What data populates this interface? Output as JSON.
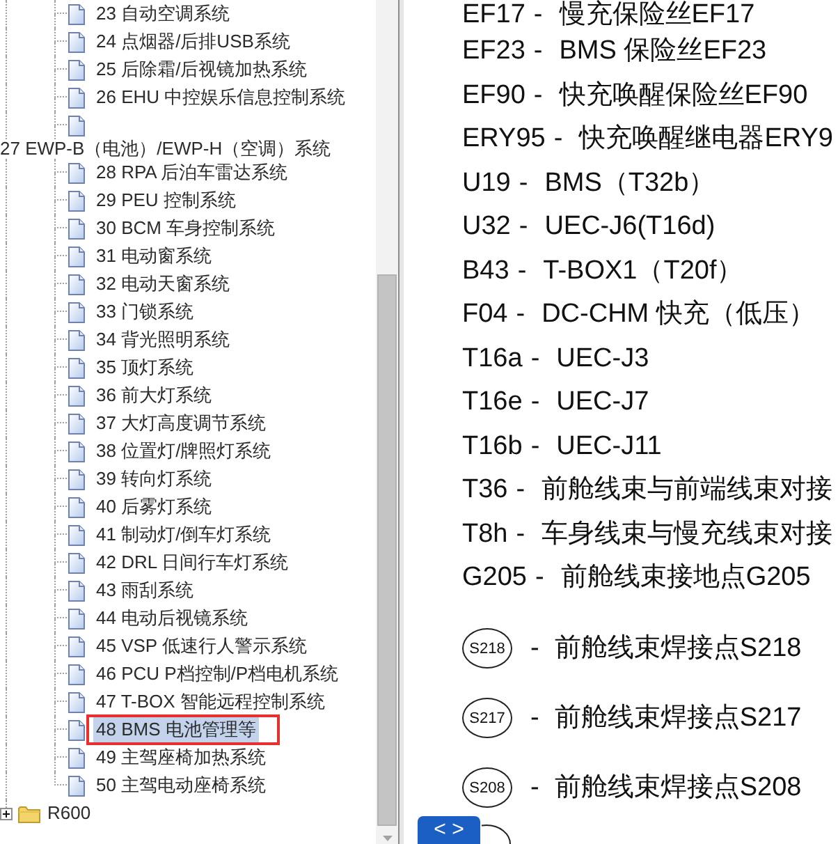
{
  "tree": [
    {
      "kind": "branch",
      "children": [
        {
          "kind": "document",
          "label": "23 自动空调系统",
          "selected": false,
          "annotated": false
        },
        {
          "kind": "document",
          "label": "24 点烟器/后排USB系统",
          "selected": false,
          "annotated": false
        },
        {
          "kind": "document",
          "label": "25 后除霜/后视镜加热系统",
          "selected": false,
          "annotated": false
        },
        {
          "kind": "document",
          "label": "26 EHU 中控娱乐信息控制系统",
          "selected": false,
          "annotated": false
        },
        {
          "kind": "document",
          "selected": false,
          "annotated": false
        },
        {
          "kind": "text_line",
          "label": "27 EWP-B（电池）/EWP-H（空调）系统"
        },
        {
          "kind": "document",
          "label": "28 RPA 后泊车雷达系统",
          "selected": false,
          "annotated": false
        },
        {
          "kind": "document",
          "label": "29 PEU 控制系统",
          "selected": false,
          "annotated": false
        },
        {
          "kind": "document",
          "label": "30 BCM 车身控制系统",
          "selected": false,
          "annotated": false
        },
        {
          "kind": "document",
          "label": "31 电动窗系统",
          "selected": false,
          "annotated": false
        },
        {
          "kind": "document",
          "label": "32 电动天窗系统",
          "selected": false,
          "annotated": false
        },
        {
          "kind": "document",
          "label": "33 门锁系统",
          "selected": false,
          "annotated": false
        },
        {
          "kind": "document",
          "label": "34 背光照明系统",
          "selected": false,
          "annotated": false
        },
        {
          "kind": "document",
          "label": "35 顶灯系统",
          "selected": false,
          "annotated": false
        },
        {
          "kind": "document",
          "label": "36 前大灯系统",
          "selected": false,
          "annotated": false
        },
        {
          "kind": "document",
          "label": "37 大灯高度调节系统",
          "selected": false,
          "annotated": false
        },
        {
          "kind": "document",
          "label": "38 位置灯/牌照灯系统",
          "selected": false,
          "annotated": false
        },
        {
          "kind": "document",
          "label": "39 转向灯系统",
          "selected": false,
          "annotated": false
        },
        {
          "kind": "document",
          "label": "40 后雾灯系统",
          "selected": false,
          "annotated": false
        },
        {
          "kind": "document",
          "label": "41 制动灯/倒车灯系统",
          "selected": false,
          "annotated": false
        },
        {
          "kind": "document",
          "label": "42 DRL 日间行车灯系统",
          "selected": false,
          "annotated": false
        },
        {
          "kind": "document",
          "label": "43 雨刮系统",
          "selected": false,
          "annotated": false
        },
        {
          "kind": "document",
          "label": "44 电动后视镜系统",
          "selected": false,
          "annotated": false
        },
        {
          "kind": "document",
          "label": "45 VSP 低速行人警示系统",
          "selected": false,
          "annotated": false
        },
        {
          "kind": "document",
          "label": "46 PCU P档控制/P档电机系统",
          "selected": false,
          "annotated": false
        },
        {
          "kind": "document",
          "label": "47 T-BOX 智能远程控制系统",
          "selected": false,
          "annotated": false
        },
        {
          "kind": "document",
          "label": "48 BMS 电池管理等",
          "selected": true,
          "annotated": true
        },
        {
          "kind": "document",
          "label": "49 主驾座椅加热系统",
          "selected": false,
          "annotated": false
        },
        {
          "kind": "document",
          "label": "50 主驾电动座椅系统",
          "selected": false,
          "annotated": false
        }
      ]
    },
    {
      "kind": "folder",
      "label": "R600",
      "expanded": false,
      "selected": false
    }
  ],
  "legend": [
    {
      "kind": "connector",
      "code": "EF17",
      "separator": "-",
      "description": "慢充保险丝EF17"
    },
    {
      "kind": "connector",
      "code": "EF23",
      "separator": "-",
      "description": "BMS 保险丝EF23"
    },
    {
      "kind": "connector",
      "code": "EF90",
      "separator": "-",
      "description": "快充唤醒保险丝EF90"
    },
    {
      "kind": "connector",
      "code": "ERY95",
      "separator": "-",
      "description": "快充唤醒继电器ERY9"
    },
    {
      "kind": "connector",
      "code": "U19",
      "separator": "-",
      "description": "BMS（T32b）"
    },
    {
      "kind": "connector",
      "code": "U32",
      "separator": "-",
      "description": "UEC-J6(T16d)"
    },
    {
      "kind": "connector",
      "code": "B43",
      "separator": "-",
      "description": "T-BOX1（T20f）"
    },
    {
      "kind": "connector",
      "code": "F04",
      "separator": "-",
      "description": "DC-CHM 快充（低压）"
    },
    {
      "kind": "connector",
      "code": "T16a",
      "separator": "-",
      "description": "UEC-J3"
    },
    {
      "kind": "connector",
      "code": "T16e",
      "separator": "-",
      "description": "UEC-J7"
    },
    {
      "kind": "connector",
      "code": "T16b",
      "separator": "-",
      "description": "UEC-J11"
    },
    {
      "kind": "connector",
      "code": "T36",
      "separator": "-",
      "description": "前舱线束与前端线束对接"
    },
    {
      "kind": "connector",
      "code": "T8h",
      "separator": "-",
      "description": "车身线束与慢充线束对接"
    },
    {
      "kind": "connector",
      "code": "G205",
      "separator": "-",
      "description": "前舱线束接地点G205"
    },
    {
      "kind": "splice",
      "code": "S218",
      "separator": "-",
      "description": "前舱线束焊接点S218"
    },
    {
      "kind": "splice",
      "code": "S217",
      "separator": "-",
      "description": "前舱线束焊接点S217"
    },
    {
      "kind": "splice",
      "code": "S208",
      "separator": "-",
      "description": "前舱线束焊接点S208"
    },
    {
      "kind": "partial"
    }
  ],
  "nav_button": {
    "label": "< >"
  }
}
